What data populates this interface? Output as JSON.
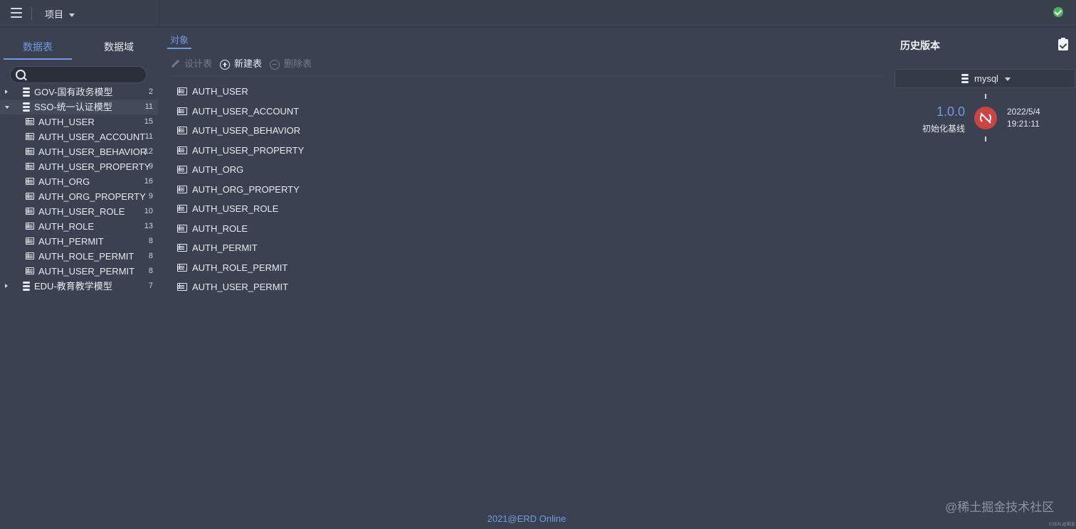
{
  "topbar": {
    "project_label": "项目"
  },
  "left": {
    "tabs": [
      "数据表",
      "数据域"
    ],
    "search_placeholder": "",
    "tree": [
      {
        "type": "db",
        "label": "GOV-国有政务模型",
        "count": "2",
        "expanded": false
      },
      {
        "type": "db",
        "label": "SSO-统一认证模型",
        "count": "11",
        "expanded": true,
        "selected": true
      },
      {
        "type": "table",
        "label": "AUTH_USER",
        "count": "15"
      },
      {
        "type": "table",
        "label": "AUTH_USER_ACCOUNT",
        "count": "11"
      },
      {
        "type": "table",
        "label": "AUTH_USER_BEHAVIOR",
        "count": "12"
      },
      {
        "type": "table",
        "label": "AUTH_USER_PROPERTY",
        "count": "9"
      },
      {
        "type": "table",
        "label": "AUTH_ORG",
        "count": "16"
      },
      {
        "type": "table",
        "label": "AUTH_ORG_PROPERTY",
        "count": "9"
      },
      {
        "type": "table",
        "label": "AUTH_USER_ROLE",
        "count": "10"
      },
      {
        "type": "table",
        "label": "AUTH_ROLE",
        "count": "13"
      },
      {
        "type": "table",
        "label": "AUTH_PERMIT",
        "count": "8"
      },
      {
        "type": "table",
        "label": "AUTH_ROLE_PERMIT",
        "count": "8"
      },
      {
        "type": "table",
        "label": "AUTH_USER_PERMIT",
        "count": "8"
      },
      {
        "type": "db",
        "label": "EDU-教育教学模型",
        "count": "7",
        "expanded": false
      }
    ]
  },
  "main": {
    "tab": "对象",
    "toolbar": {
      "design": "设计表",
      "new": "新建表",
      "delete": "删除表"
    },
    "objects": [
      "AUTH_USER",
      "AUTH_USER_ACCOUNT",
      "AUTH_USER_BEHAVIOR",
      "AUTH_USER_PROPERTY",
      "AUTH_ORG",
      "AUTH_ORG_PROPERTY",
      "AUTH_USER_ROLE",
      "AUTH_ROLE",
      "AUTH_PERMIT",
      "AUTH_ROLE_PERMIT",
      "AUTH_USER_PERMIT"
    ]
  },
  "history": {
    "title": "历史版本",
    "db_type": "mysql",
    "version": "1.0.0",
    "description": "初始化基线",
    "date": "2022/5/4",
    "time": "19:21:11"
  },
  "footer": "2021@ERD Online",
  "watermark": "@稀土掘金技术社区",
  "watermark_small": "CSDN @掘金",
  "colors": {
    "background": "#3b4150",
    "accent": "#6f9be0",
    "badge_red": "#c94444",
    "status_green": "#4fb35e"
  }
}
